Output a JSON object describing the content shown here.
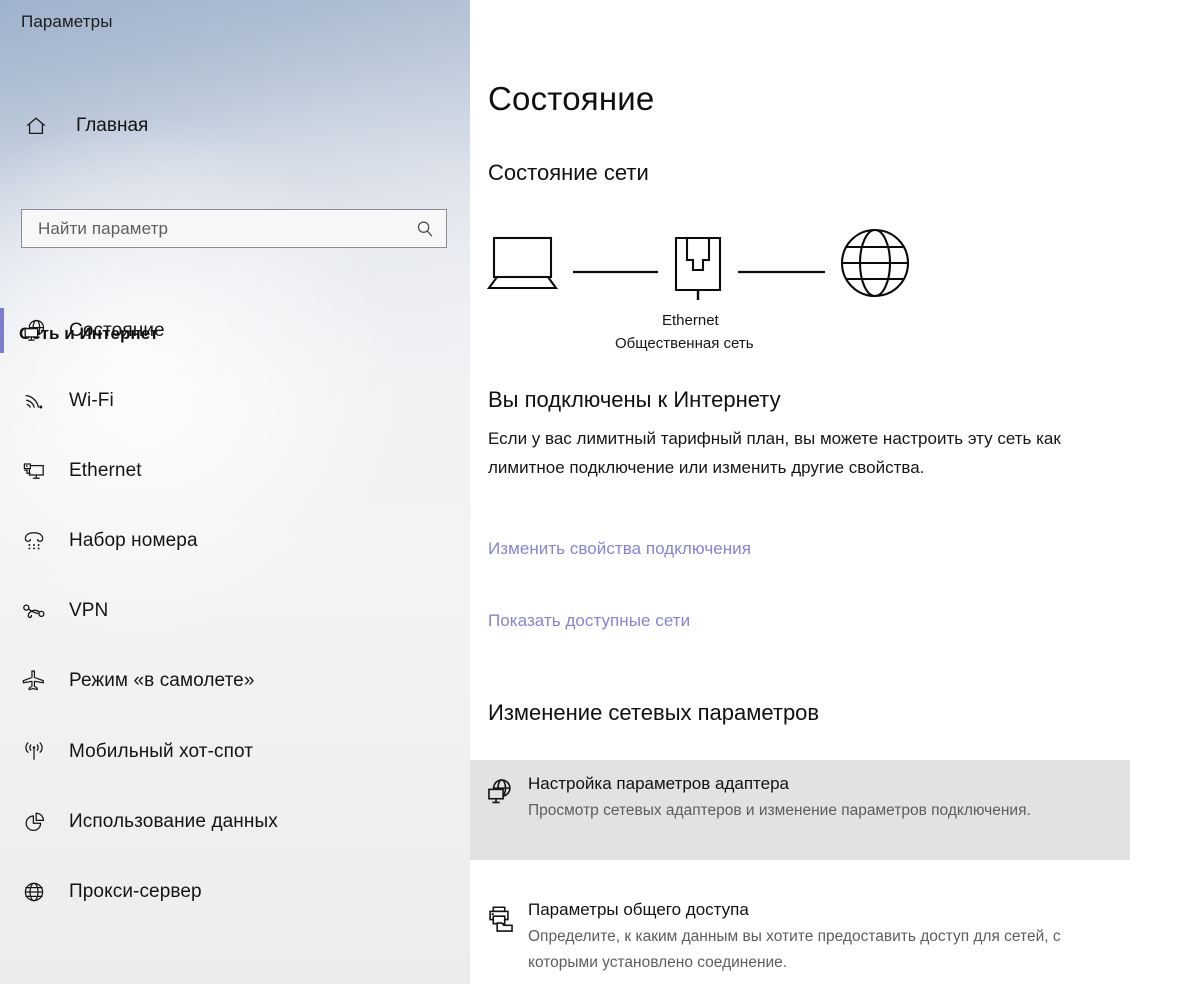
{
  "app": {
    "title": "Параметры"
  },
  "sidebar": {
    "home": {
      "label": "Главная",
      "icon": "home-icon"
    },
    "search": {
      "placeholder": "Найти параметр",
      "value": "",
      "icon": "search-icon"
    },
    "category": "Сеть и Интернет",
    "accent_color": "#7d7ec9",
    "items": [
      {
        "label": "Состояние",
        "icon": "globe-monitor-icon",
        "selected": true
      },
      {
        "label": "Wi-Fi",
        "icon": "wifi-icon",
        "selected": false
      },
      {
        "label": "Ethernet",
        "icon": "ethernet-monitor-icon",
        "selected": false
      },
      {
        "label": "Набор номера",
        "icon": "dialup-phone-icon",
        "selected": false
      },
      {
        "label": "VPN",
        "icon": "vpn-icon",
        "selected": false
      },
      {
        "label": "Режим «в самолете»",
        "icon": "airplane-icon",
        "selected": false
      },
      {
        "label": "Мобильный хот-спот",
        "icon": "hotspot-antenna-icon",
        "selected": false
      },
      {
        "label": "Использование данных",
        "icon": "pie-chart-icon",
        "selected": false
      },
      {
        "label": "Прокси-сервер",
        "icon": "globe-icon",
        "selected": false
      }
    ]
  },
  "main": {
    "page_title": "Состояние",
    "network_status_heading": "Состояние сети",
    "diagram": {
      "device_icon": "laptop-icon",
      "adapter_icon": "ethernet-plug-icon",
      "internet_icon": "globe-icon",
      "connection_name": "Ethernet",
      "network_profile": "Общественная сеть"
    },
    "status_heading": "Вы подключены к Интернету",
    "status_description": "Если у вас лимитный тарифный план, вы можете настроить эту сеть как лимитное подключение или изменить другие свойства.",
    "links": [
      {
        "label": "Изменить свойства подключения"
      },
      {
        "label": "Показать доступные сети"
      }
    ],
    "link_color": "#8484d4",
    "change_settings_heading": "Изменение сетевых параметров",
    "settings": [
      {
        "title": "Настройка параметров адаптера",
        "description": "Просмотр сетевых адаптеров и изменение параметров подключения.",
        "icon": "globe-monitor-icon",
        "highlighted": true,
        "highlight_color": "#e2e2e2"
      },
      {
        "title": "Параметры общего доступа",
        "description": "Определите, к каким данным вы хотите предоставить доступ для сетей, с которыми установлено соединение.",
        "icon": "printer-folder-icon",
        "highlighted": false
      }
    ]
  }
}
